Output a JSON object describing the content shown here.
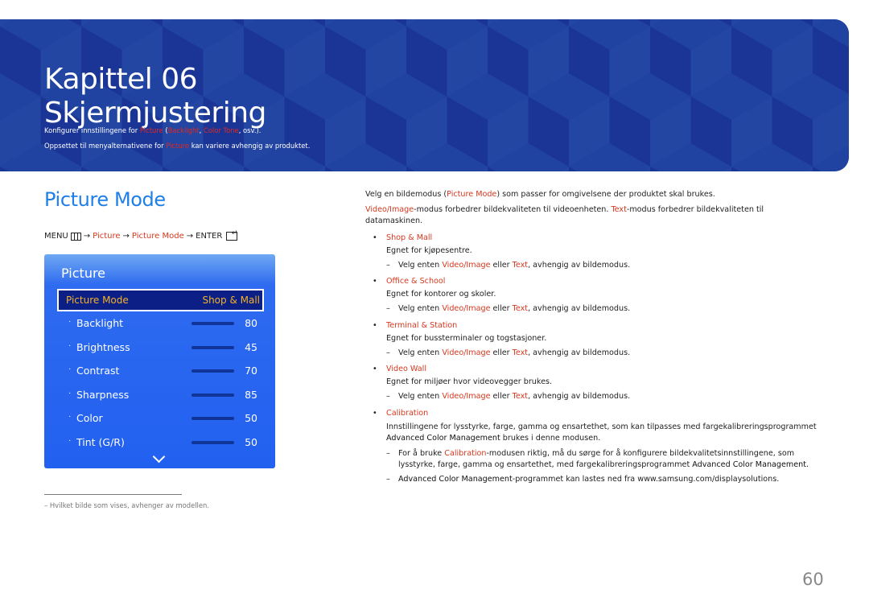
{
  "banner": {
    "chapter": "Kapittel 06",
    "title": "Skjermjustering",
    "desc1": {
      "pre": "Konfigurer innstillingene for ",
      "picture": "Picture",
      "mid1": " (",
      "backlight": "Backlight",
      "comma": ", ",
      "color_tone": "Color Tone",
      "post": ", osv.)."
    },
    "desc2": {
      "pre": "Oppsettet til menyalternativene for ",
      "picture": "Picture",
      "post": " kan variere avhengig av produktet."
    },
    "colors": {
      "background": "#1e3a9c",
      "highlight": "#e4281e"
    }
  },
  "section": {
    "title": "Picture Mode",
    "menu_path": {
      "menu": "MENU",
      "arrow": "→",
      "picture": "Picture",
      "picture_mode": "Picture Mode",
      "enter": "ENTER"
    }
  },
  "osd": {
    "title": "Picture",
    "selected": {
      "label": "Picture Mode",
      "value": "Shop & Mall"
    },
    "items": [
      {
        "label": "Backlight",
        "value": 80,
        "fraction": 0.8
      },
      {
        "label": "Brightness",
        "value": 45,
        "fraction": 0.45
      },
      {
        "label": "Contrast",
        "value": 70,
        "fraction": 0.7
      },
      {
        "label": "Sharpness",
        "value": 85,
        "fraction": 0.85
      },
      {
        "label": "Color",
        "value": 50,
        "fraction": 0.5
      },
      {
        "label": "Tint (G/R)",
        "value": 50,
        "fraction": 0.5
      }
    ],
    "bullet": "·"
  },
  "footnote": "–  Hvilket bilde som vises, avhenger av modellen.",
  "right": {
    "intro": {
      "pre": "Velg en bildemodus (",
      "hl": "Picture Mode",
      "post": ") som passer for omgivelsene der produktet skal brukes."
    },
    "intro2": {
      "hl1": "Video/Image",
      "mid": "-modus forbedrer bildekvaliteten til videoenheten. ",
      "hl2": "Text",
      "post": "-modus forbedrer bildekvaliteten til",
      "line2": "datamaskinen."
    },
    "bullet": "•",
    "dash": "–",
    "modes": [
      {
        "title": "Shop & Mall",
        "desc": "Egnet for kjøpesentre."
      },
      {
        "title": "Office & School",
        "desc": "Egnet for kontorer og skoler."
      },
      {
        "title": "Terminal & Station",
        "desc": "Egnet for bussterminaler og togstasjoner."
      },
      {
        "title": "Video Wall",
        "desc": "Egnet for miljøer hvor videovegger brukes."
      }
    ],
    "mode_note": {
      "pre": "Velg enten ",
      "hl1": "Video/Image",
      "mid": " eller ",
      "hl2": "Text",
      "post": ", avhengig av bildemodus."
    },
    "calibration": {
      "title": "Calibration",
      "desc1": "Innstillingene for lysstyrke, farge, gamma og ensartethet, som kan tilpasses med fargekalibreringsprogrammet",
      "desc2_strong": "Advanced Color Management",
      "desc2_post": " brukes i denne modusen.",
      "note1_pre": "For å bruke ",
      "note1_hl": "Calibration",
      "note1_post": "-modusen riktig, må du sørge for å konfigurere bildekvalitetsinnstillingene, som",
      "note1_line2_pre": "lysstyrke, farge, gamma og ensartethet, med fargekalibreringsprogrammet ",
      "note1_line2_strong": "Advanced Color Management",
      "note1_line2_post": ".",
      "note2_strong": "Advanced Color Management",
      "note2_post": "-programmet kan lastes ned fra www.samsung.com/displaysolutions."
    }
  },
  "page_number": "60"
}
